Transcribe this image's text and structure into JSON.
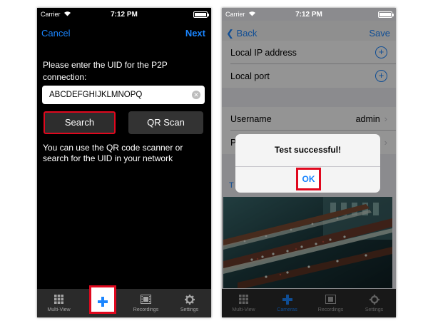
{
  "left": {
    "status": {
      "carrier": "Carrier",
      "time": "7:12 PM"
    },
    "nav": {
      "cancel": "Cancel",
      "next": "Next"
    },
    "prompt": "Please enter the UID for the P2P connection:",
    "uid_value": "ABCDEFGHIJKLMNOPQ",
    "search_label": "Search",
    "qr_label": "QR Scan",
    "help": "You can use the QR code scanner or search for the UID in your network",
    "tabs": [
      {
        "label": "Multi-View",
        "icon": "grid-icon"
      },
      {
        "label": "",
        "icon": "plus-icon"
      },
      {
        "label": "Recordings",
        "icon": "film-icon"
      },
      {
        "label": "Settings",
        "icon": "gear-icon"
      }
    ]
  },
  "right": {
    "status": {
      "carrier": "Carrier",
      "time": "7:12 PM"
    },
    "nav": {
      "back": "Back",
      "save": "Save"
    },
    "rows": [
      {
        "label": "Local IP address"
      },
      {
        "label": "Local port"
      },
      {
        "label": "Username",
        "value": "admin"
      },
      {
        "label": "P"
      }
    ],
    "section_label": "T",
    "dialog": {
      "message": "Test successful!",
      "ok": "OK"
    },
    "tabs": [
      {
        "label": "Multi-View",
        "icon": "grid-icon"
      },
      {
        "label": "Cameras",
        "icon": "plus-icon"
      },
      {
        "label": "Recordings",
        "icon": "film-icon"
      },
      {
        "label": "Settings",
        "icon": "gear-icon"
      }
    ]
  },
  "colors": {
    "accent": "#1a85ff",
    "highlight": "#e0081e"
  }
}
